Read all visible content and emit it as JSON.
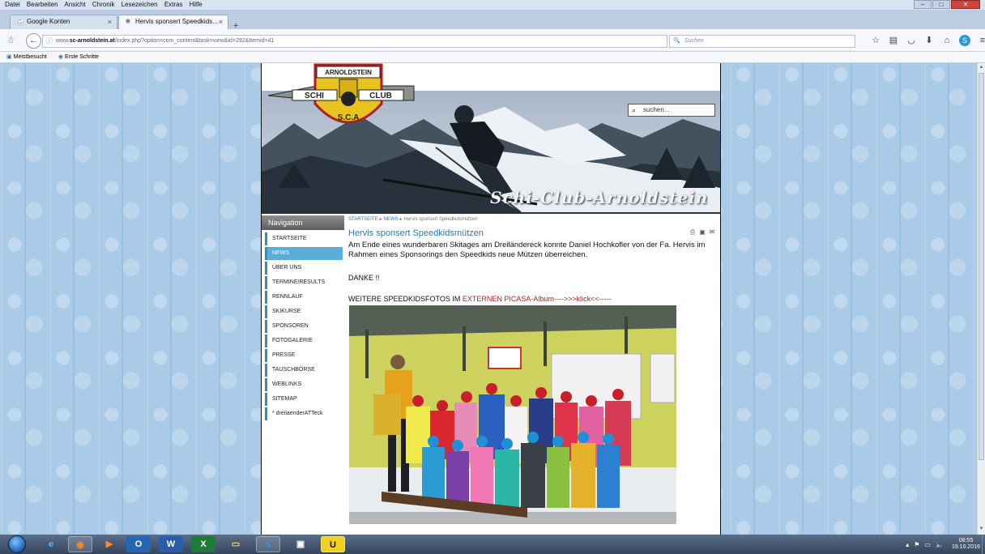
{
  "browser": {
    "menu": [
      "Datei",
      "Bearbeiten",
      "Ansicht",
      "Chronik",
      "Lesezeichen",
      "Extras",
      "Hilfe"
    ],
    "tabs": [
      {
        "title": "Google Konten",
        "close": "×"
      },
      {
        "title": "Hervis sponsert Speedkids...",
        "close": "×"
      }
    ],
    "new_tab": "+",
    "url_prefix": "www.",
    "url_host": "sc-arnoldstein.at",
    "url_path": "/index.php?option=com_content&task=view&id=292&Itemid=41",
    "search_placeholder": "Suchen",
    "bookmarks": [
      "Meistbesucht",
      "Erste Schritte"
    ]
  },
  "site": {
    "logo": {
      "top": "ARNOLDSTEIN",
      "left": "SCHI",
      "right": "CLUB",
      "bottom": "S.C.A"
    },
    "search_placeholder": "suchen...",
    "title": "Schi-Club-Arnoldstein",
    "nav_header": "Navigation",
    "nav_items": [
      "STARTSEITE",
      "NEWS",
      "ÜBER UNS",
      "TERMINE/RESULTS",
      "RENNLAUF",
      "SKIKURSE",
      "SPONSOREN",
      "FOTOGALERIE",
      "PRESSE",
      "TAUSCHBÖRSE",
      "WEBLINKS",
      "SITEMAP",
      "* dreilaenderATTeck"
    ],
    "breadcrumb": [
      "STARTSEITE",
      "NEWS",
      "Hervis sponsert Speedkidsmützen"
    ],
    "article": {
      "title": "Hervis sponsert Speedkidsmützen",
      "text": "Am Ende eines wunderbaren Skitages am Dreiländereck konnte Daniel Hochkofler von der Fa. Hervis im Rahmen eines Sponsorings den Speedkids neue Mützen überreichen.",
      "thanks": "DANKE !!",
      "more_prefix": "WEITERE SPEEDKIDSFOTOS IM ",
      "more_link": "EXTERNEN PICASA-Album---->>>klick<<-----"
    }
  },
  "taskbar": {
    "clock_time": "08:55",
    "clock_date": "19.10.2016"
  }
}
